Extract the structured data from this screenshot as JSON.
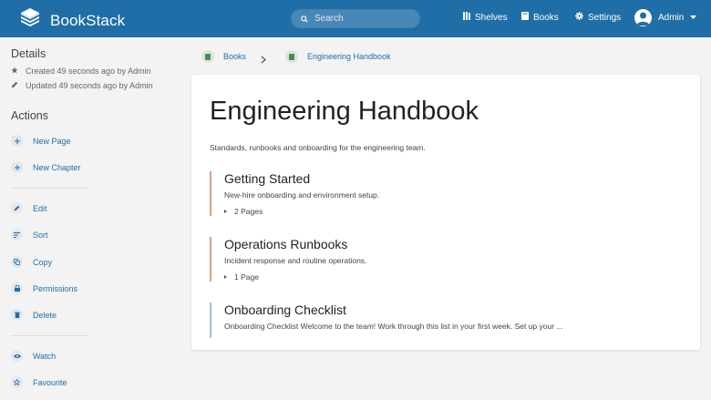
{
  "header": {
    "app_name": "BookStack",
    "search_placeholder": "Search",
    "nav": {
      "shelves": "Shelves",
      "books": "Books",
      "settings": "Settings"
    },
    "user_name": "Admin"
  },
  "sidebar": {
    "details_title": "Details",
    "created": "Created 49 seconds ago by Admin",
    "updated": "Updated 49 seconds ago by Admin",
    "actions_title": "Actions",
    "actions": {
      "new_page": "New Page",
      "new_chapter": "New Chapter",
      "edit": "Edit",
      "sort": "Sort",
      "copy": "Copy",
      "permissions": "Permissions",
      "delete": "Delete",
      "watch": "Watch",
      "favourite": "Favourite"
    }
  },
  "breadcrumb": {
    "books": "Books",
    "current": "Engineering Handbook"
  },
  "book": {
    "title": "Engineering Handbook",
    "description": "Standards, runbooks and onboarding for the engineering team.",
    "items": [
      {
        "title": "Getting Started",
        "description": "New-hire onboarding and environment setup.",
        "count": "2 Pages"
      },
      {
        "title": "Operations Runbooks",
        "description": "Incident response and routine operations.",
        "count": "1 Page"
      },
      {
        "title": "Onboarding Checklist",
        "description": "Onboarding Checklist Welcome to the team! Work through this list in your first week. Set up your ..."
      }
    ]
  },
  "colors": {
    "header": "#206ea7",
    "link": "#206ea7",
    "chapter_accent": "#d5a282",
    "page_accent": "#a9bfd8"
  }
}
